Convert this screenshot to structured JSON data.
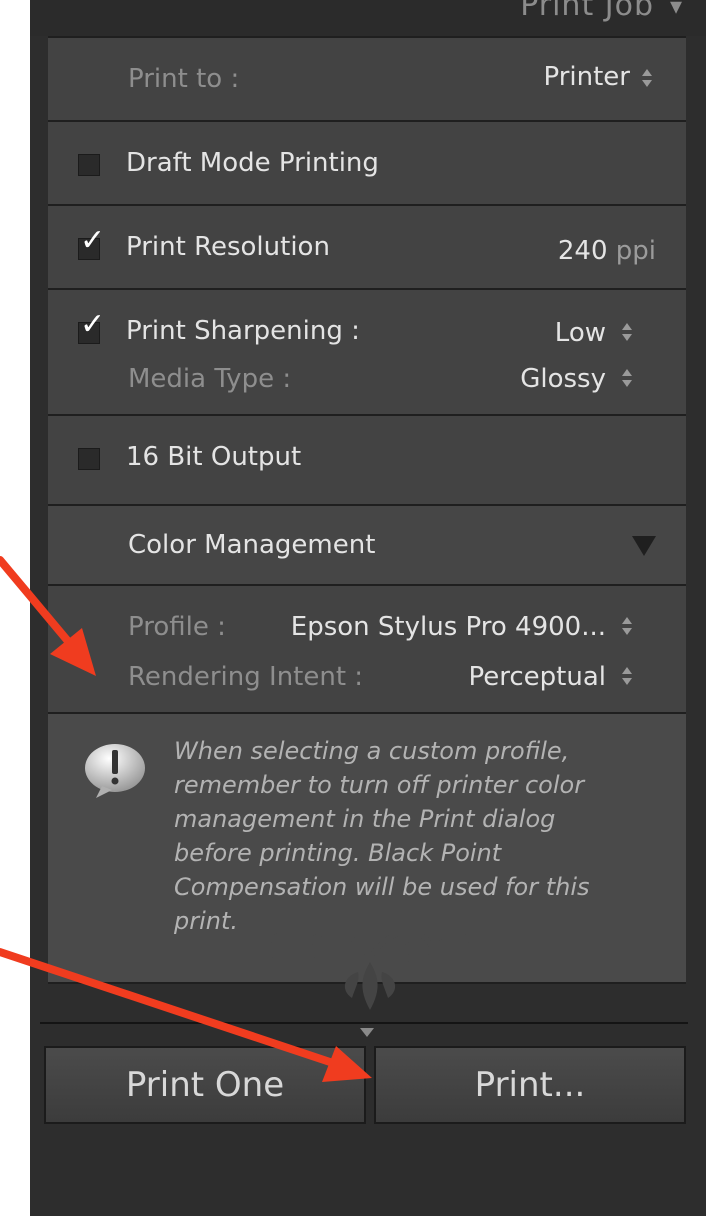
{
  "panel": {
    "title": "Print Job"
  },
  "print_to": {
    "label": "Print to :",
    "value": "Printer"
  },
  "draft_mode": {
    "label": "Draft Mode Printing",
    "checked": false
  },
  "print_resolution": {
    "label": "Print Resolution",
    "checked": true,
    "value": "240",
    "unit": "ppi"
  },
  "print_sharpening": {
    "label": "Print Sharpening :",
    "checked": true,
    "value": "Low"
  },
  "media_type": {
    "label": "Media Type :",
    "value": "Glossy"
  },
  "bit_output": {
    "label": "16 Bit Output",
    "checked": false
  },
  "color_management": {
    "title": "Color Management",
    "profile_label": "Profile :",
    "profile_value": "Epson Stylus Pro 4900...",
    "intent_label": "Rendering Intent :",
    "intent_value": "Perceptual"
  },
  "warning": {
    "lines": [
      "When selecting a custom profile,",
      "remember to turn off printer color",
      "management in the Print dialog",
      "before printing. Black Point",
      "Compensation will be used for this",
      "print."
    ]
  },
  "buttons": {
    "print_one": "Print One",
    "print": "Print..."
  },
  "colors": {
    "panel_bg": "#2d2d2d",
    "section_bg": "#434343",
    "annotation_arrow": "#f03c1f"
  },
  "icons": [
    "stepper-icon",
    "checkmark-icon",
    "disclosure-triangle-icon",
    "alert-bubble-icon",
    "ornament-icon"
  ]
}
